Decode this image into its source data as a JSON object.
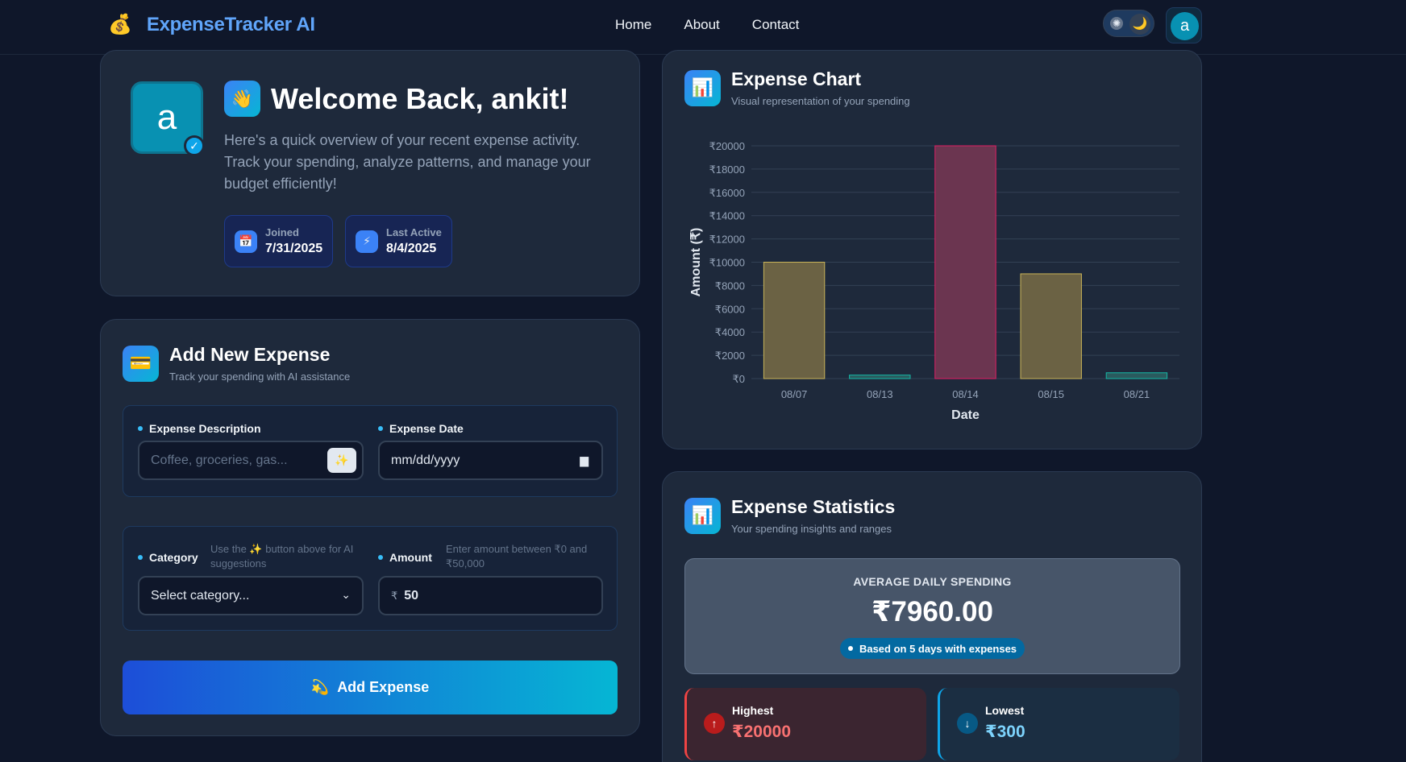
{
  "nav": {
    "brand_icon": "💰",
    "brand_name": "ExpenseTracker AI",
    "links": [
      "Home",
      "About",
      "Contact"
    ],
    "theme_icons": {
      "sun": "✺",
      "moon": "🌙"
    },
    "avatar_letter": "a"
  },
  "welcome": {
    "avatar_letter": "a",
    "verified_icon": "✓",
    "wave_icon": "👋",
    "title": "Welcome Back, ankit!",
    "text": "Here's a quick overview of your recent expense activity. Track your spending, analyze patterns, and manage your budget efficiently!",
    "joined_icon": "📅",
    "joined_label": "Joined",
    "joined_value": "7/31/2025",
    "active_icon": "⚡",
    "active_label": "Last Active",
    "active_value": "8/4/2025"
  },
  "add_expense": {
    "icon": "💳",
    "title": "Add New Expense",
    "subtitle": "Track your spending with AI assistance",
    "description_label": "Expense Description",
    "description_placeholder": "Coffee, groceries, gas...",
    "ai_button_icon": "✨",
    "date_label": "Expense Date",
    "date_value": "mm/dd/yyyy",
    "category_label": "Category",
    "category_hint": "Use the ✨ button above for AI suggestions",
    "category_value": "Select category...",
    "amount_label": "Amount",
    "amount_hint": "Enter amount between ₹0 and ₹50,000",
    "currency_symbol": "₹",
    "amount_value": "50",
    "submit_icon": "💫",
    "submit_label": "Add Expense"
  },
  "chart_card": {
    "icon": "📊",
    "title": "Expense Chart",
    "subtitle": "Visual representation of your spending"
  },
  "chart_data": {
    "type": "bar",
    "categories": [
      "08/07",
      "08/13",
      "08/14",
      "08/15",
      "08/21"
    ],
    "values": [
      10000,
      300,
      20000,
      9000,
      500
    ],
    "bar_colors": [
      "#6b6244",
      "#2a5a5e",
      "#6b3550",
      "#6b6244",
      "#2a5a5e"
    ],
    "bar_borders": [
      "#c9b458",
      "#14b8a6",
      "#e11d63",
      "#c9b458",
      "#14b8a6"
    ],
    "xlabel": "Date",
    "ylabel": "Amount (₹)",
    "ylim": [
      0,
      20000
    ],
    "yticks": [
      0,
      2000,
      4000,
      6000,
      8000,
      10000,
      12000,
      14000,
      16000,
      18000,
      20000
    ],
    "ytick_prefix": "₹",
    "grid": true
  },
  "stats": {
    "icon": "📊",
    "title": "Expense Statistics",
    "subtitle": "Your spending insights and ranges",
    "avg_label": "AVERAGE DAILY SPENDING",
    "avg_value": "₹7960.00",
    "avg_note": "Based on 5 days with expenses",
    "highest_icon": "↑",
    "highest_label": "Highest",
    "highest_value": "₹20000",
    "lowest_icon": "↓",
    "lowest_label": "Lowest",
    "lowest_value": "₹300"
  }
}
